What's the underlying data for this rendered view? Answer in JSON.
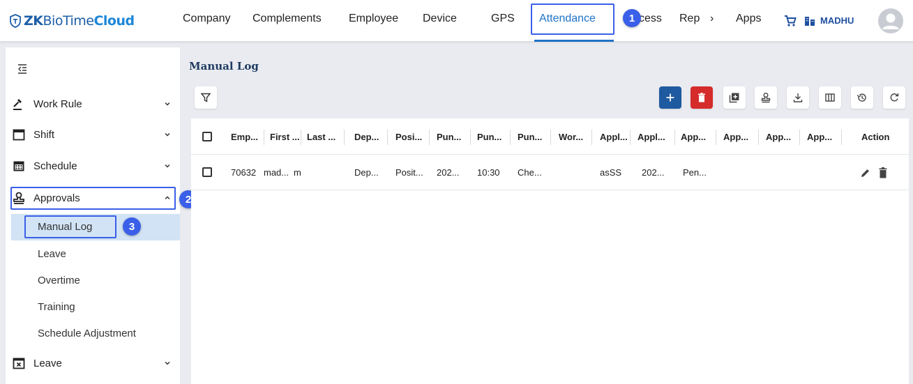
{
  "app": {
    "logo_zk": "ZK",
    "logo_bio": "BioTime",
    "logo_cloud": "Cloud"
  },
  "nav": {
    "items": [
      "Company",
      "Complements",
      "Employee",
      "Device",
      "GPS",
      "Attendance",
      "cess",
      "Rep",
      "Apps"
    ],
    "more": "›",
    "user": "MADHU"
  },
  "annotations": [
    "1",
    "2",
    "3"
  ],
  "sidebar": {
    "menus": [
      {
        "label": "Work Rule",
        "icon": "gavel-icon"
      },
      {
        "label": "Shift",
        "icon": "calendar-icon"
      },
      {
        "label": "Schedule",
        "icon": "calendar-grid-icon"
      },
      {
        "label": "Approvals",
        "icon": "approval-stamp-icon"
      },
      {
        "label": "Leave",
        "icon": "calendar-x-icon"
      }
    ],
    "approvals_sub": [
      "Manual Log",
      "Leave",
      "Overtime",
      "Training",
      "Schedule Adjustment"
    ]
  },
  "page": {
    "title": "Manual Log"
  },
  "table": {
    "headers": [
      "Emp...",
      "First ...",
      "Last ...",
      "Dep...",
      "Posi...",
      "Pun...",
      "Pun...",
      "Pun...",
      "Wor...",
      "Appl...",
      "Appl...",
      "App...",
      "App...",
      "App...",
      "App...",
      "Action"
    ],
    "rows": [
      [
        "70632",
        "mad...",
        "m",
        "Dep...",
        "Posit...",
        "202...",
        "10:30",
        "Che...",
        "",
        "asSS",
        "202...",
        "Pen...",
        "",
        "",
        ""
      ]
    ]
  },
  "colors": {
    "accent": "#1f73c7",
    "annotation": "#3a5fe8",
    "add_button": "#1e5aa0",
    "delete_button": "#d52b2b",
    "selected_row": "#d1e3f5"
  }
}
